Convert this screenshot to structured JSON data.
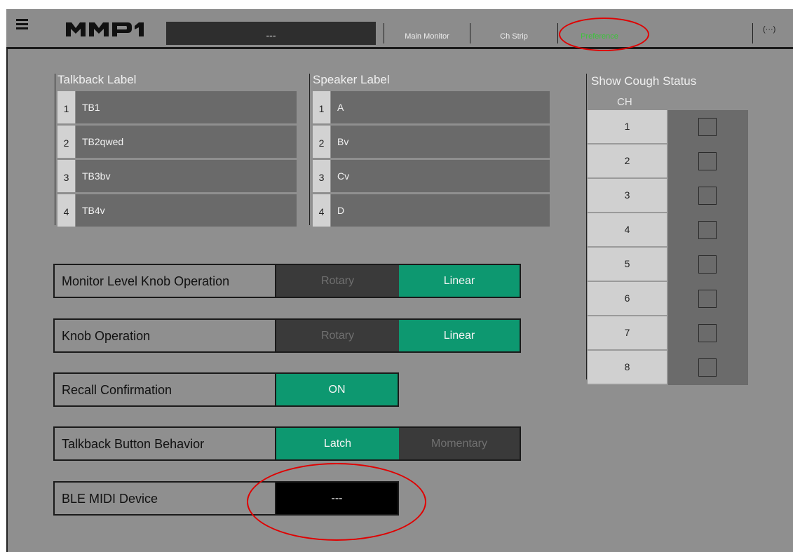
{
  "header": {
    "logo": "MMP1",
    "scene_display": "---",
    "tabs": [
      {
        "label": "Main Monitor"
      },
      {
        "label": "Ch Strip"
      },
      {
        "label": "Preference"
      }
    ],
    "bluetooth_label": "(···)"
  },
  "talkback": {
    "title": "Talkback Label",
    "rows": [
      {
        "num": "1",
        "value": "TB1"
      },
      {
        "num": "2",
        "value": "TB2qwed"
      },
      {
        "num": "3",
        "value": "TB3bv"
      },
      {
        "num": "4",
        "value": "TB4v"
      }
    ]
  },
  "speaker": {
    "title": "Speaker Label",
    "rows": [
      {
        "num": "1",
        "value": "A"
      },
      {
        "num": "2",
        "value": "Bv"
      },
      {
        "num": "3",
        "value": "Cv"
      },
      {
        "num": "4",
        "value": "D"
      }
    ]
  },
  "settings": {
    "monitor_knob": {
      "label": "Monitor Level Knob Operation",
      "opt1": "Rotary",
      "opt2": "Linear",
      "selected": "Linear"
    },
    "knob": {
      "label": "Knob Operation",
      "opt1": "Rotary",
      "opt2": "Linear",
      "selected": "Linear"
    },
    "recall": {
      "label": "Recall Confirmation",
      "value": "ON"
    },
    "talkback_button": {
      "label": "Talkback Button Behavior",
      "opt1": "Latch",
      "opt2": "Momentary",
      "selected": "Latch"
    },
    "ble_midi": {
      "label": "BLE MIDI Device",
      "value": "---"
    }
  },
  "cough": {
    "title": "Show Cough Status",
    "ch_header": "CH",
    "channels": [
      {
        "ch": "1",
        "checked": false
      },
      {
        "ch": "2",
        "checked": false
      },
      {
        "ch": "3",
        "checked": false
      },
      {
        "ch": "4",
        "checked": false
      },
      {
        "ch": "5",
        "checked": false
      },
      {
        "ch": "6",
        "checked": false
      },
      {
        "ch": "7",
        "checked": false
      },
      {
        "ch": "8",
        "checked": false
      }
    ]
  },
  "colors": {
    "accent_selected": "#0d9870",
    "active_tab": "#3dc33b",
    "annotation": "#e00000",
    "background": "#8f8f8f"
  }
}
